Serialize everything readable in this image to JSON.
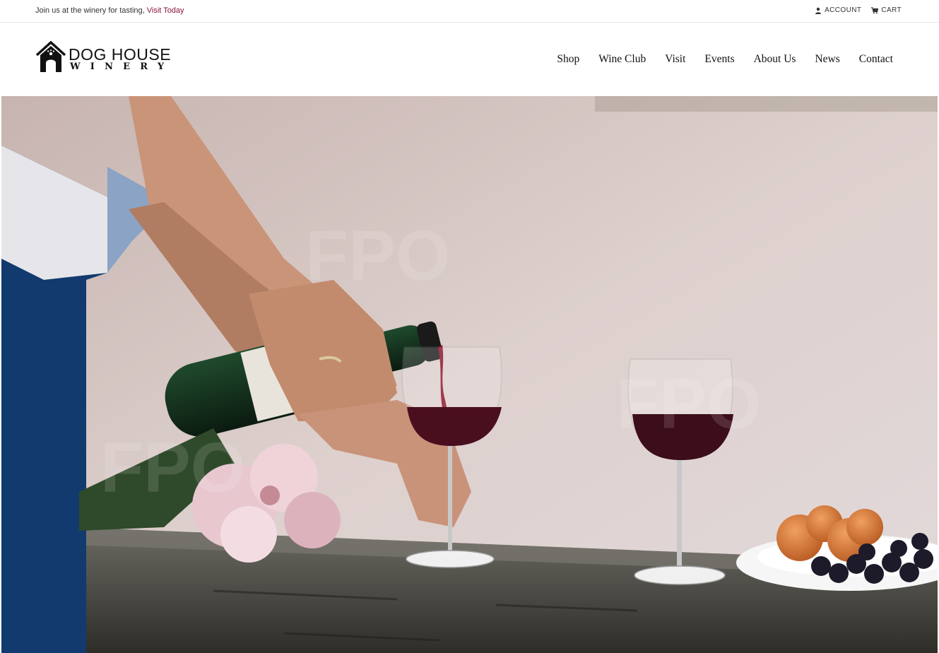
{
  "topbar": {
    "promo_text": "Join us at the winery for tasting,",
    "promo_link": "Visit Today",
    "account_label": "ACCOUNT",
    "cart_label": "CART",
    "account_icon": "user-icon",
    "cart_icon": "cart-icon"
  },
  "logo": {
    "line1": "DOG HOUSE",
    "line2": "WINERY"
  },
  "nav": {
    "items": [
      "Shop",
      "Wine Club",
      "Visit",
      "Events",
      "About Us",
      "News",
      "Contact"
    ]
  },
  "hero": {
    "watermark": "FPO"
  },
  "colors": {
    "link_accent": "#8a1538",
    "wine": "#4a0f1f",
    "text": "#111111"
  }
}
